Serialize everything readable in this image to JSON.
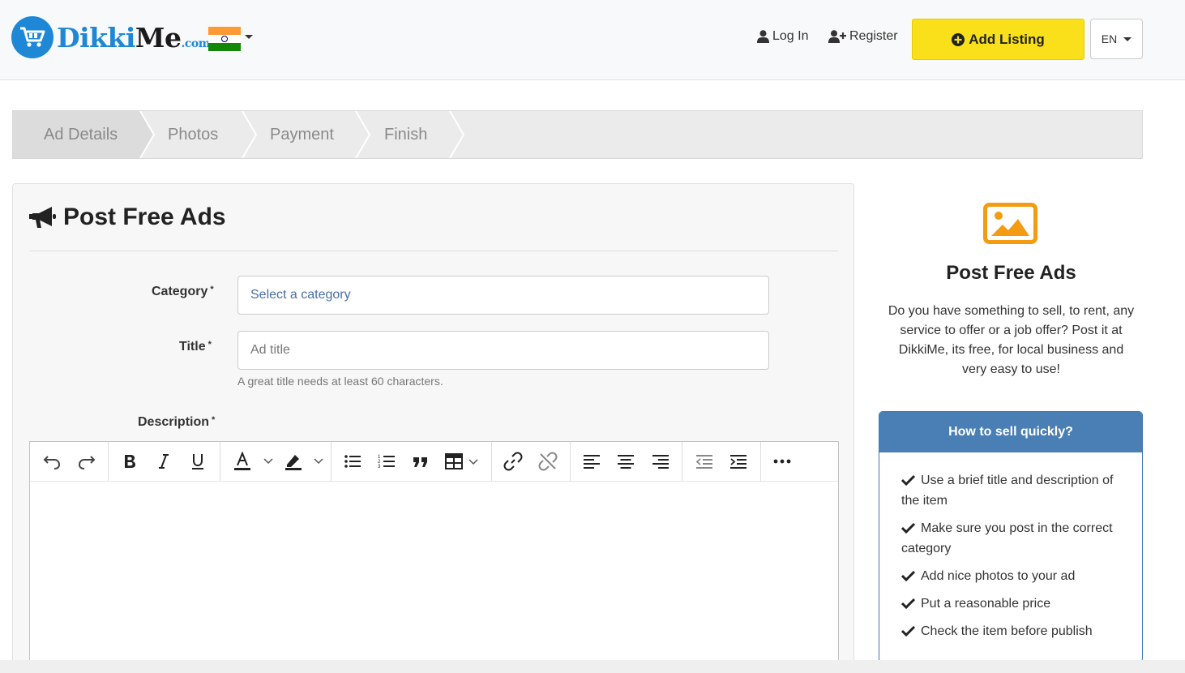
{
  "header": {
    "logo_main": "Dikki",
    "logo_me": "Me",
    "logo_suffix": ".com",
    "login_label": "Log In",
    "register_label": "Register",
    "add_listing_label": "Add Listing",
    "language_label": "EN"
  },
  "steps": [
    {
      "label": "Ad Details",
      "active": true
    },
    {
      "label": "Photos",
      "active": false
    },
    {
      "label": "Payment",
      "active": false
    },
    {
      "label": "Finish",
      "active": false
    }
  ],
  "form": {
    "title": "Post Free Ads",
    "category_label": "Category",
    "category_placeholder": "Select a category",
    "title_label": "Title",
    "title_placeholder": "Ad title",
    "title_hint": "A great title needs at least 60 characters.",
    "description_label": "Description",
    "required_mark": "*"
  },
  "editor_toolbar": [
    "undo-icon",
    "redo-icon",
    "bold-icon",
    "italic-icon",
    "underline-icon",
    "font-color-icon",
    "highlight-icon",
    "bulleted-list-icon",
    "numbered-list-icon",
    "blockquote-icon",
    "table-icon",
    "link-icon",
    "unlink-icon",
    "align-left-icon",
    "align-center-icon",
    "align-right-icon",
    "outdent-icon",
    "indent-icon",
    "more-icon"
  ],
  "sidebar": {
    "title": "Post Free Ads",
    "text": "Do you have something to sell, to rent, any service to offer or a job offer? Post it at DikkiMe, its free, for local business and very easy to use!",
    "tips_title": "How to sell quickly?",
    "tips": [
      "Use a brief title and description of the item",
      "Make sure you post in the correct category",
      "Add nice photos to your ad",
      "Put a reasonable price",
      "Check the item before publish"
    ]
  },
  "colors": {
    "brand_blue": "#1e88d6",
    "accent_yellow": "#f9e01b",
    "accent_orange": "#f39c12",
    "tips_header": "#4a7fb5"
  }
}
